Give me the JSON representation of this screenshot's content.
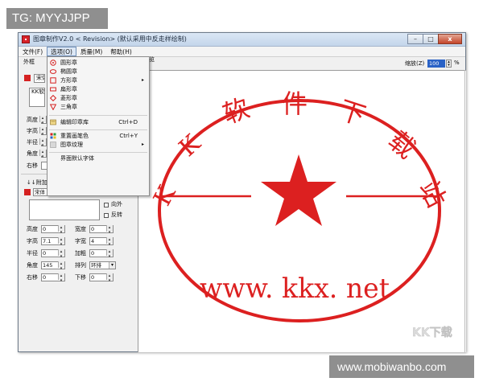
{
  "watermark_tl": "TG: MYYJJPP",
  "watermark_br": "www.mobiwanbo.com",
  "window": {
    "title": "图章制作V2.0  < Revision>  (默认采用中反走样绘制)",
    "buttons": {
      "minimize": "–",
      "maximize": "□",
      "close": "x"
    }
  },
  "menu": [
    {
      "label": "文件(F)"
    },
    {
      "label": "选项(O)"
    },
    {
      "label": "质量(M)"
    },
    {
      "label": "帮助(H)"
    }
  ],
  "dropdown": {
    "items": [
      {
        "label": "圆形章"
      },
      {
        "label": "椭圆章"
      },
      {
        "label": "方形章",
        "submenu": "▸"
      },
      {
        "label": "扁形章"
      },
      {
        "label": "菱形章"
      },
      {
        "label": "三角章"
      },
      {
        "label": "编辑印章库",
        "shortcut": "Ctrl+D"
      },
      {
        "label": "重置画笔色",
        "shortcut": "Ctrl+Y"
      },
      {
        "label": "图章纹理",
        "submenu": "▸"
      },
      {
        "label": "界面默认字体"
      }
    ]
  },
  "left": {
    "outer_label": "外框",
    "font_top": "宋体",
    "text_top": "KK软件",
    "labels_top": [
      "高度",
      "字高",
      "半径",
      "角度",
      "右移"
    ],
    "down_label": "下移",
    "add_text_title": "↓↓附加文本↓↓",
    "font2": "宋体",
    "texture_label": "纹理",
    "outward_label": "向外",
    "reverse_label": "反转",
    "fields2": {
      "height_label": "高度",
      "height_val": "0",
      "width_label": "宽度",
      "width_val": "0",
      "charh_label": "字高",
      "charh_val": "7.1",
      "charw_label": "字宽",
      "charw_val": "4",
      "radius_label": "半径",
      "radius_val": "0",
      "bold_label": "加粗",
      "bold_val": "0",
      "angle_label": "角度",
      "angle_val": "145",
      "arrange_label": "排列",
      "arrange_val": "环排",
      "right_label": "右移",
      "right_val": "0",
      "down_label": "下移",
      "down_val": "0"
    }
  },
  "preview": {
    "label": "预览",
    "zoom_label": "缩放(Z)",
    "zoom_value": "100",
    "zoom_unit": "%"
  },
  "stamp": {
    "arc_text": [
      "K",
      "K",
      "软",
      "件",
      "下",
      "载",
      "站"
    ],
    "bottom_text": "www. kkx. net",
    "watermark": "KK下载",
    "color": "#dc2020"
  }
}
